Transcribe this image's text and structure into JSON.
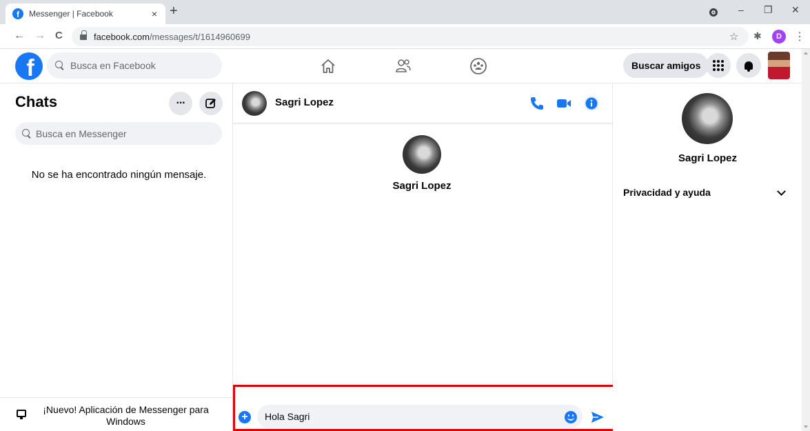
{
  "browser": {
    "tab_title": "Messenger | Facebook",
    "tab_close": "×",
    "new_tab": "+",
    "url_host": "facebook.com",
    "url_path": "/messages/t/1614960699",
    "profile_initial": "D",
    "window_controls": {
      "minimize": "–",
      "restore": "❐",
      "close": "✕"
    },
    "nav": {
      "back": "←",
      "forward": "→",
      "reload": "C"
    },
    "star": "☆",
    "extensions": "✱",
    "menu": "⋮"
  },
  "facebook": {
    "logo_letter": "f",
    "search_placeholder": "Busca en Facebook",
    "find_friends_label": "Buscar amigos"
  },
  "chats_panel": {
    "title": "Chats",
    "more_label": "···",
    "search_placeholder": "Busca en Messenger",
    "empty_message": "No se ha encontrado ningún mensaje.",
    "promo_text": "¡Nuevo! Aplicación de Messenger para Windows"
  },
  "conversation": {
    "contact_name": "Sagri Lopez",
    "composer_value": "Hola Sagri",
    "composer_plus": "+"
  },
  "info_panel": {
    "contact_name": "Sagri Lopez",
    "privacy_label": "Privacidad y ayuda"
  },
  "colors": {
    "brand_blue": "#1877f2",
    "highlight_red": "#e00000"
  }
}
